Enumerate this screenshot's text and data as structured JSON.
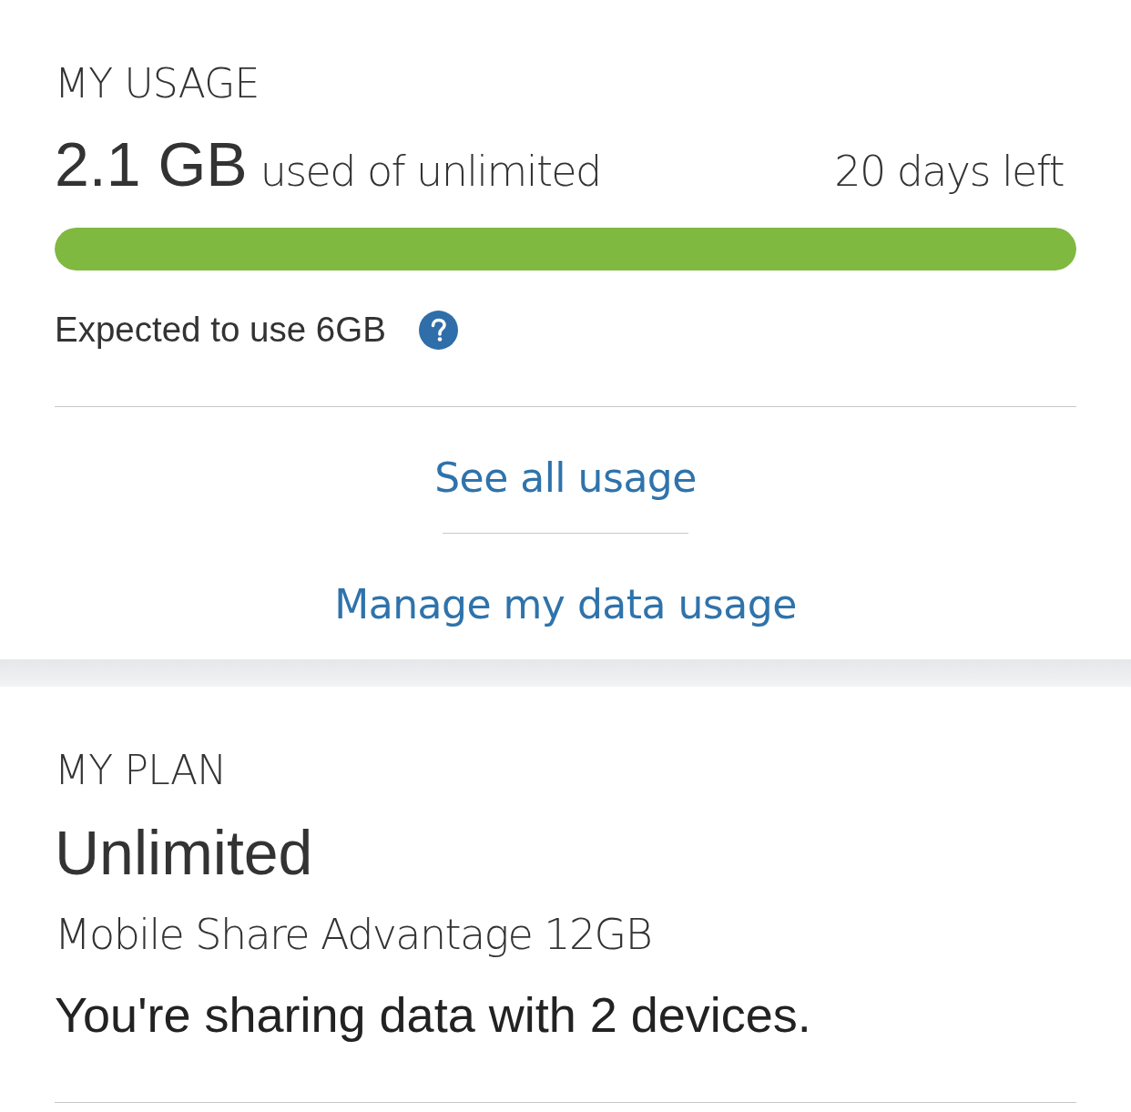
{
  "usage": {
    "title": "MY USAGE",
    "amount": "2.1 GB",
    "amount_note": "used of unlimited",
    "days_left": "20 days left",
    "bar": {
      "level": 1
    },
    "expected": "Expected to use 6GB",
    "links": [
      "See all usage",
      "Manage my data usage"
    ]
  },
  "plan": {
    "title": "MY PLAN",
    "name": "Unlimited",
    "plan_name": "Mobile Share Advantage 12GB",
    "sharing": "You're sharing data with 2 devices."
  }
}
